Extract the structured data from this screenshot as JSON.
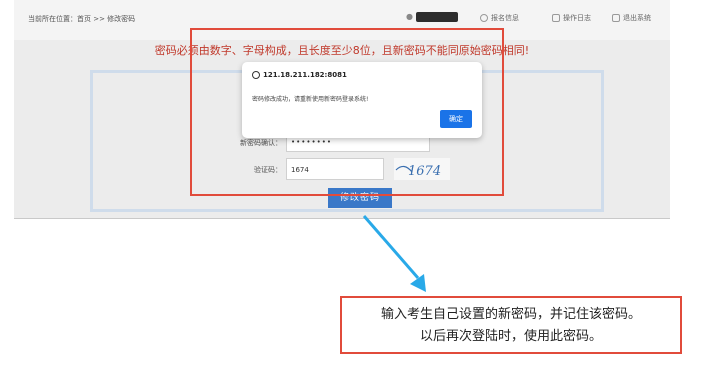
{
  "breadcrumb": "当前所在位置：首页 >> 修改密码",
  "nav": {
    "report_info": "报名信息",
    "operation_log": "操作日志",
    "logout": "退出系统"
  },
  "notice": "密码必须由数字、字母构成，且长度至少8位，且新密码不能同原始密码相同!",
  "form": {
    "confirm_label": "新密码确认：",
    "confirm_value": "••••••••",
    "captcha_label": "验证码：",
    "captcha_value": "1674",
    "captcha_image_text": "1674",
    "submit_label": "修改密码"
  },
  "dialog": {
    "host": "121.18.211.182:8081",
    "message": "密码修改成功，请重新使用新密码登录系统!",
    "ok_label": "确定"
  },
  "callout": {
    "line1": "输入考生自己设置的新密码，并记住该密码。",
    "line2": "以后再次登陆时，使用此密码。"
  },
  "colors": {
    "annotation_red": "#e14b3b",
    "notice_red": "#c0392b",
    "primary_blue": "#1a73e8",
    "arrow_blue": "#29a9e8"
  }
}
